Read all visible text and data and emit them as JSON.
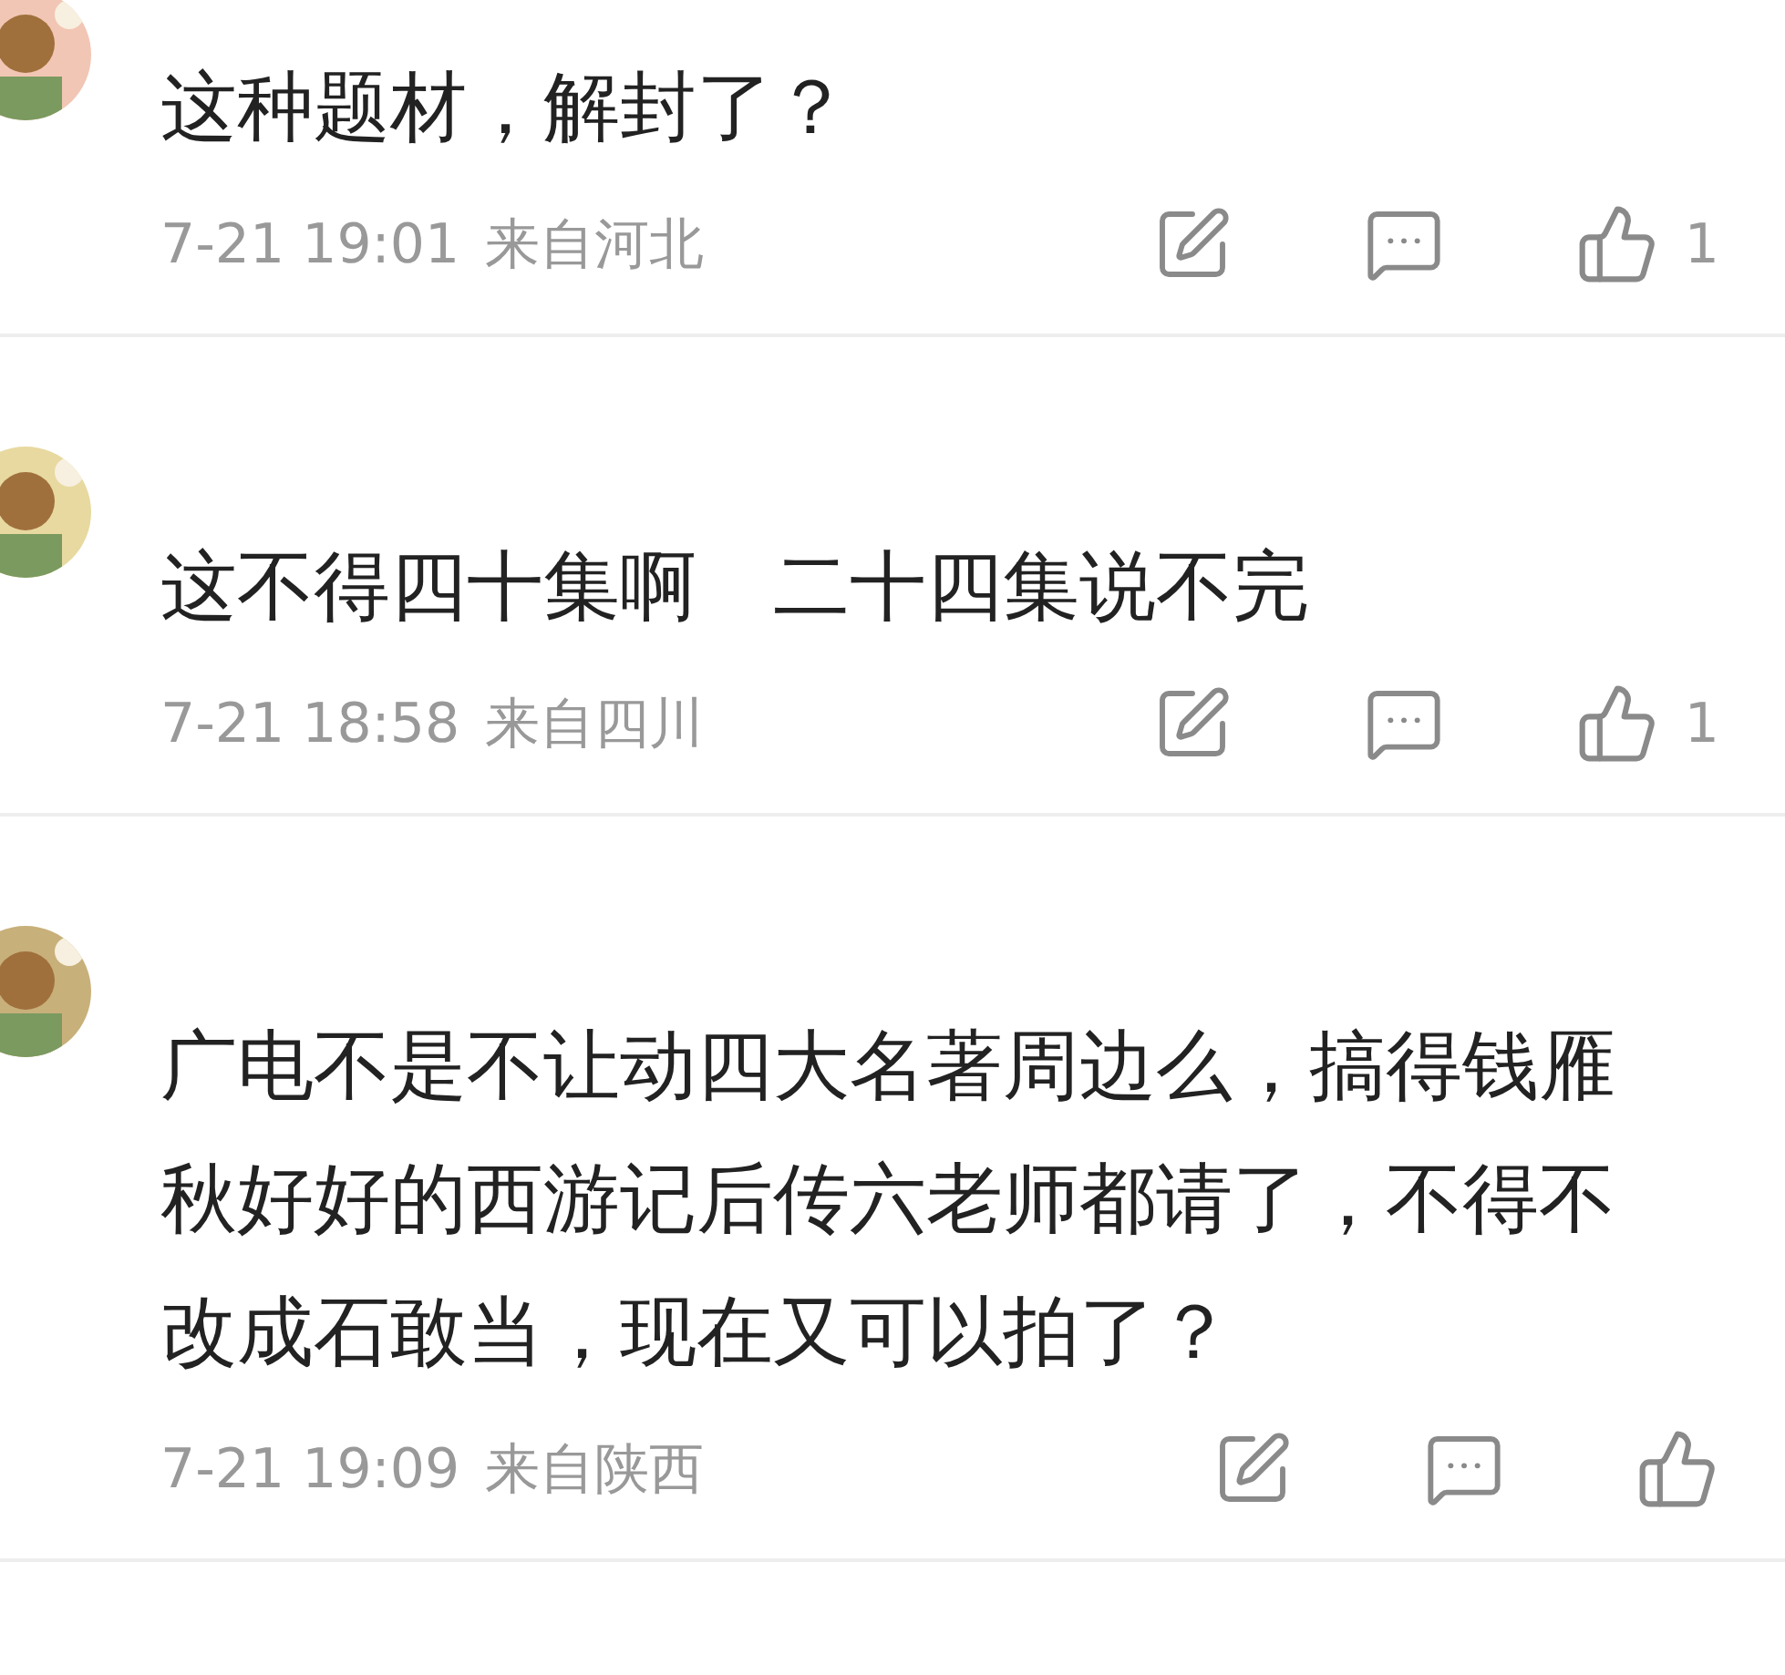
{
  "comments": [
    {
      "text": "这种题材，解封了？",
      "time": "7-21 19:01",
      "location": "来自河北",
      "likes": "1"
    },
    {
      "text": "这不得四十集啊　二十四集说不完",
      "time": "7-21 18:58",
      "location": "来自四川",
      "likes": "1"
    },
    {
      "text": "广电不是不让动四大名著周边么，搞得钱雁秋好好的西游记后传六老师都请了，不得不改成石敢当，现在又可以拍了？",
      "time": "7-21 19:09",
      "location": "来自陕西"
    }
  ]
}
